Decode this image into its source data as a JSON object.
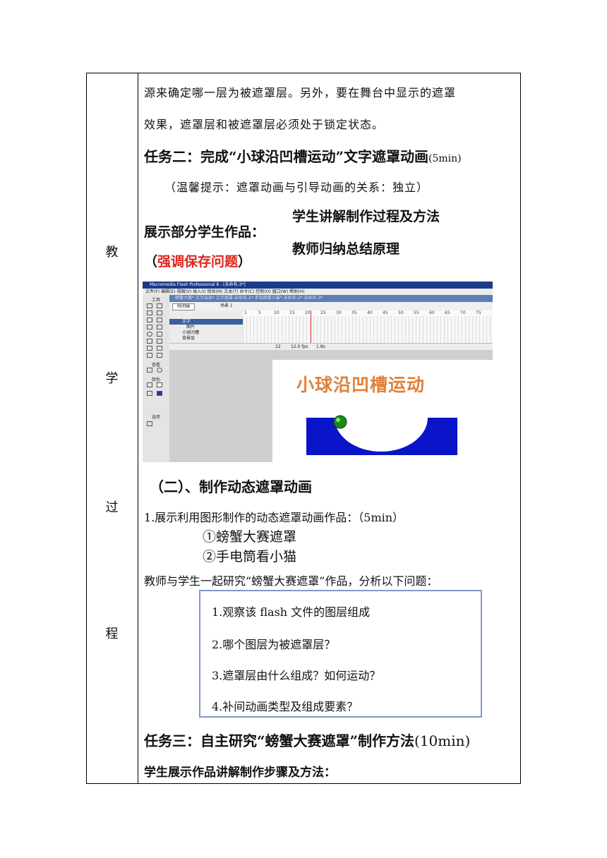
{
  "side_labels": [
    "教",
    "学",
    "过",
    "程"
  ],
  "lines": {
    "l1": "源来确定哪一层为被遮罩层。另外，要在舞台中显示的遮罩",
    "l2": "效果，遮罩层和被遮罩层必须处于锁定状态。",
    "task2_title": "任务二：完成“小球沿凹槽运动”文字遮罩动画",
    "task2_time": "(5min)",
    "tip": "（温馨提示：遮罩动画与引导动画的关系：独立）",
    "show_label": "展示部分学生作品：",
    "student_explain": "学生讲解制作过程及方法",
    "teacher_summary": "教师归纳总结原理",
    "emph_open": "（",
    "emph_red": "强调保存问题",
    "emph_close": "）",
    "section2": "（二）、制作动态遮罩动画",
    "item1": "1.展示利用图形制作的动态遮罩动画作品：",
    "item1_time": "（5min）",
    "work1": "①螃蟹大赛遮罩",
    "work2": "②手电筒看小猫",
    "study": "教师与学生一起研究“螃蟹大赛遮罩”作品，分析以下问题：",
    "task3_title": "任务三：自主研究“螃蟹大赛遮罩”制作方法",
    "task3_time": "(10min)",
    "last": "学生展示作品讲解制作步骤及方法："
  },
  "questions": [
    "1.观察该 flash 文件的图层组成",
    "2.哪个图层为被遮罩层？",
    "3.遮罩层由什么组成？如何运动？",
    "4.补间动画类型及组成要素？"
  ],
  "flash": {
    "title": "Macromedia Flash Professional 8 - [未命名-3*]",
    "menu": "文件(F)  编辑(E)  视图(V)  插入(I)  修改(M)  文本(T)  命令(C)  控制(O)  窗口(W)  帮助(H)",
    "tabs": "螃蟹大赛*   文字出现*   文字遮罩   未命名-1*   手电筒看小猫*   未命名-2*   未命名-3*",
    "tools_label": "工具",
    "view_label": "查看",
    "color_label": "颜色",
    "options_label": "选项",
    "timeline_btn": "时间轴",
    "scene": "场景 1",
    "layers": [
      "文字",
      "图片",
      "小球凹槽",
      "背景层"
    ],
    "ruler": [
      "1",
      "5",
      "10",
      "15",
      "20",
      "25",
      "30",
      "35",
      "40",
      "45",
      "50",
      "55",
      "60",
      "65",
      "70",
      "75"
    ],
    "frame": "22",
    "fps": "12.0 fps",
    "time": "1.8s",
    "stage_text": "小球沿凹槽运动",
    "colors": {
      "title_bar": "#1b3a8a",
      "stage_text": "#e0803a",
      "groove": "#0a14c8",
      "ball": "#1a8a1a"
    }
  }
}
